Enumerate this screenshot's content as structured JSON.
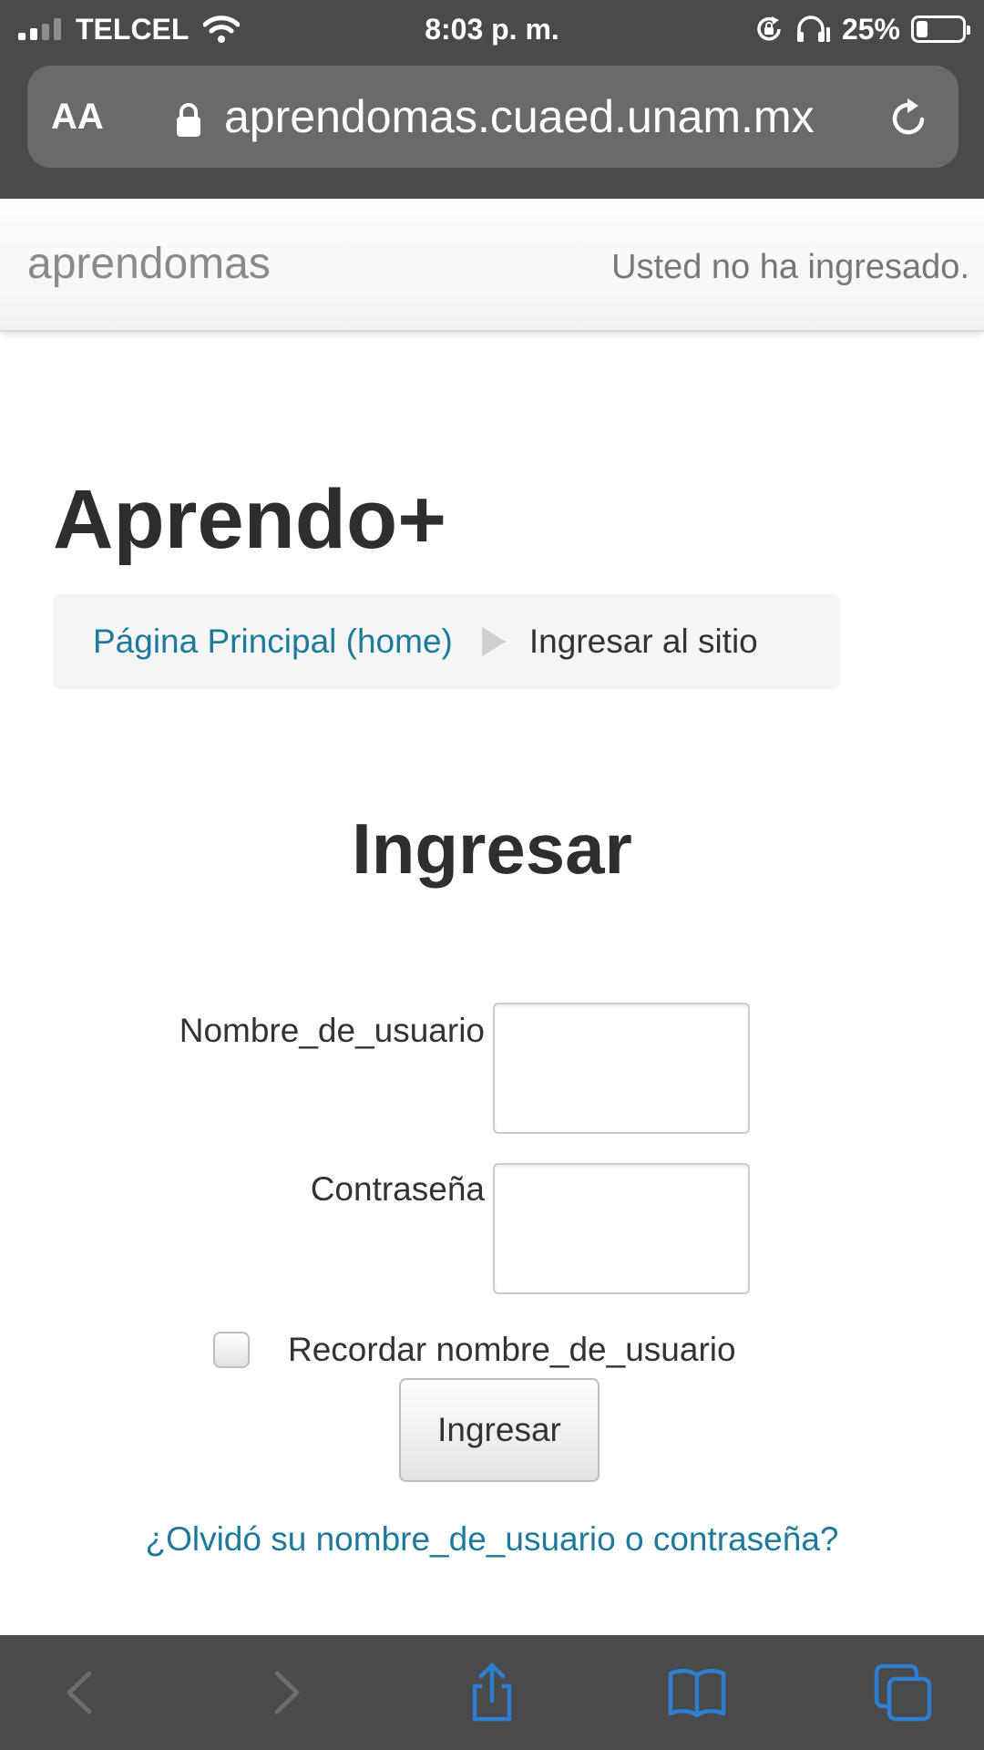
{
  "status_bar": {
    "carrier": "TELCEL",
    "time": "8:03 p. m.",
    "battery_percent": "25%",
    "signal_bars": 2,
    "battery_level": 0.25,
    "icons": [
      "signal-icon",
      "wifi-icon",
      "rotation-lock-icon",
      "headphones-icon",
      "battery-icon"
    ]
  },
  "address_bar": {
    "text_size_label": "AA",
    "url": "aprendomas.cuaed.unam.mx",
    "icons": [
      "lock-icon",
      "reload-icon"
    ]
  },
  "site_header": {
    "brand": "aprendomas",
    "login_info": "Usted no ha ingresado."
  },
  "page": {
    "title": "Aprendo+",
    "breadcrumb": {
      "home_link": "Página Principal (home)",
      "current": "Ingresar al sitio"
    }
  },
  "login_form": {
    "heading": "Ingresar",
    "username_label": "Nombre_de_usuario",
    "username_value": "",
    "password_label": "Contraseña",
    "password_value": "",
    "remember_label": "Recordar nombre_de_usuario",
    "remember_checked": false,
    "submit_label": "Ingresar",
    "forgot_link": "¿Olvidó su nombre_de_usuario o contraseña?"
  },
  "toolbar": {
    "icons": [
      "back-icon",
      "forward-icon",
      "share-icon",
      "bookmarks-icon",
      "tabs-icon"
    ]
  },
  "colors": {
    "chrome": "#4a4a4a",
    "url_field": "#6a6a6a",
    "link": "#1e7a9c",
    "ios_blue": "#2f7fd1",
    "disabled_icon": "#6d6d6d"
  }
}
